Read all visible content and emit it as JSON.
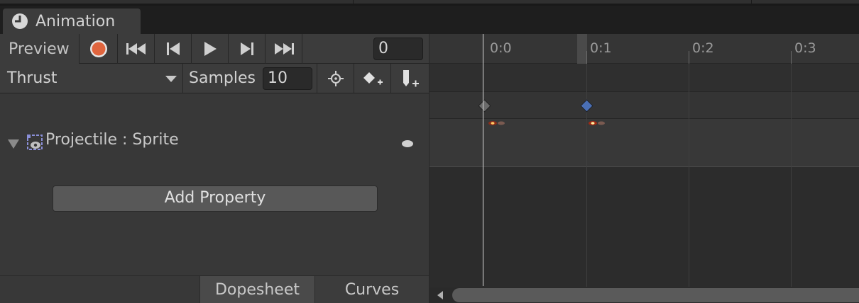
{
  "window": {
    "tab_title": "Animation"
  },
  "toolbar": {
    "preview_label": "Preview",
    "frame_value": "0",
    "icons": [
      "record-icon",
      "first-key-icon",
      "prev-key-icon",
      "play-icon",
      "next-key-icon",
      "last-key-icon"
    ]
  },
  "clipbar": {
    "clip_name": "Thrust",
    "samples_label": "Samples",
    "samples_value": "10",
    "icons": [
      "filter-by-selection-icon",
      "add-keyframe-icon",
      "add-event-icon"
    ]
  },
  "properties": [
    {
      "label": "Projectile : Sprite",
      "icon": "sprite-renderer-icon"
    }
  ],
  "add_property_label": "Add Property",
  "modes": {
    "dopesheet": "Dopesheet",
    "curves": "Curves",
    "active": "Dopesheet"
  },
  "timeline": {
    "ticks": [
      "0:0",
      "0:1",
      "0:2",
      "0:3"
    ],
    "keyframe_times": [
      0,
      0.1
    ]
  },
  "colors": {
    "record": "#e0653e",
    "key_selected": "#4a6fb5",
    "key_normal": "#6b6b6b"
  }
}
